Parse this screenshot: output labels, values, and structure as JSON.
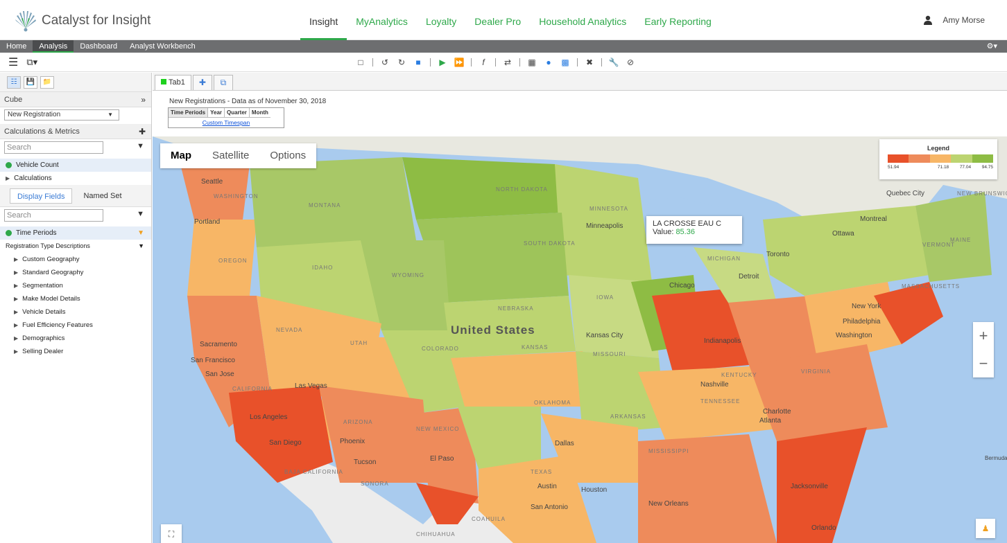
{
  "brand": {
    "name": "Catalyst for Insight"
  },
  "topnav": [
    "Insight",
    "MyAnalytics",
    "Loyalty",
    "Dealer Pro",
    "Household Analytics",
    "Early Reporting"
  ],
  "user": {
    "name": "Amy Morse"
  },
  "subnav": [
    "Home",
    "Analysis",
    "Dashboard",
    "Analyst Workbench"
  ],
  "subnav_active": "Analysis",
  "leftpanel": {
    "cube_label": "Cube",
    "cube_select": "New Registration",
    "calc_label": "Calculations & Metrics",
    "search_placeholder": "Search",
    "metrics": [
      "Vehicle Count",
      "Calculations"
    ],
    "tabs": [
      "Display Fields",
      "Named Set"
    ],
    "search2_placeholder": "Search",
    "time_periods": "Time Periods",
    "reg_type": "Registration Type Descriptions",
    "tree": [
      "Custom Geography",
      "Standard Geography",
      "Segmentation",
      "Make Model Details",
      "Vehicle Details",
      "Fuel Efficiency Features",
      "Demographics",
      "Selling Dealer"
    ]
  },
  "doc": {
    "tab": "Tab1",
    "report_title": "New Registrations - Data as of November 30, 2018",
    "periods": [
      "Time Periods",
      "Year",
      "Quarter",
      "Month"
    ],
    "custom_link": "Custom Timespan"
  },
  "map": {
    "types": [
      "Map",
      "Satellite",
      "Options"
    ],
    "legend_title": "Legend",
    "legend_ticks": [
      "51.94",
      "71.18",
      "77.04",
      "94.75"
    ],
    "legend_colors": [
      "#e8512a",
      "#ee8b5b",
      "#f7b666",
      "#bcd471",
      "#8ebc44"
    ],
    "tooltip_name": "LA CROSSE EAU C",
    "tooltip_value_label": "Value:",
    "tooltip_value": "85.36",
    "country_label": "United States",
    "cities": [
      "Seattle",
      "Portland",
      "Sacramento",
      "San Francisco",
      "San Jose",
      "Las Vegas",
      "Los Angeles",
      "San Diego",
      "Phoenix",
      "Tucson",
      "El Paso",
      "Dallas",
      "Austin",
      "Houston",
      "San Antonio",
      "Kansas City",
      "Chicago",
      "Minneapolis",
      "Detroit",
      "Toronto",
      "Montreal",
      "Ottawa",
      "Quebec City",
      "New York",
      "Philadelphia",
      "Washington",
      "Nashville",
      "Atlanta",
      "Charlotte",
      "Jacksonville",
      "Orlando",
      "New Orleans",
      "Indianapolis"
    ],
    "states": [
      "WASHINGTON",
      "MONTANA",
      "NORTH DAKOTA",
      "MINNESOTA",
      "SOUTH DAKOTA",
      "OREGON",
      "IDAHO",
      "WYOMING",
      "NEBRASKA",
      "IOWA",
      "NEVADA",
      "UTAH",
      "COLORADO",
      "KANSAS",
      "CALIFORNIA",
      "ARIZONA",
      "NEW MEXICO",
      "OKLAHOMA",
      "TEXAS",
      "ARKANSAS",
      "MISSISSIPPI",
      "TENNESSEE",
      "KENTUCKY",
      "MISSOURI",
      "MICHIGAN",
      "BAJA CALIFORNIA",
      "SONORA",
      "CHIHUAHUA",
      "COAHUILA",
      "NEW BRUNSWICK",
      "VERMONT",
      "MAINE",
      "MASSACHUSETTS",
      "VIRGINIA",
      "Bermuda"
    ]
  }
}
